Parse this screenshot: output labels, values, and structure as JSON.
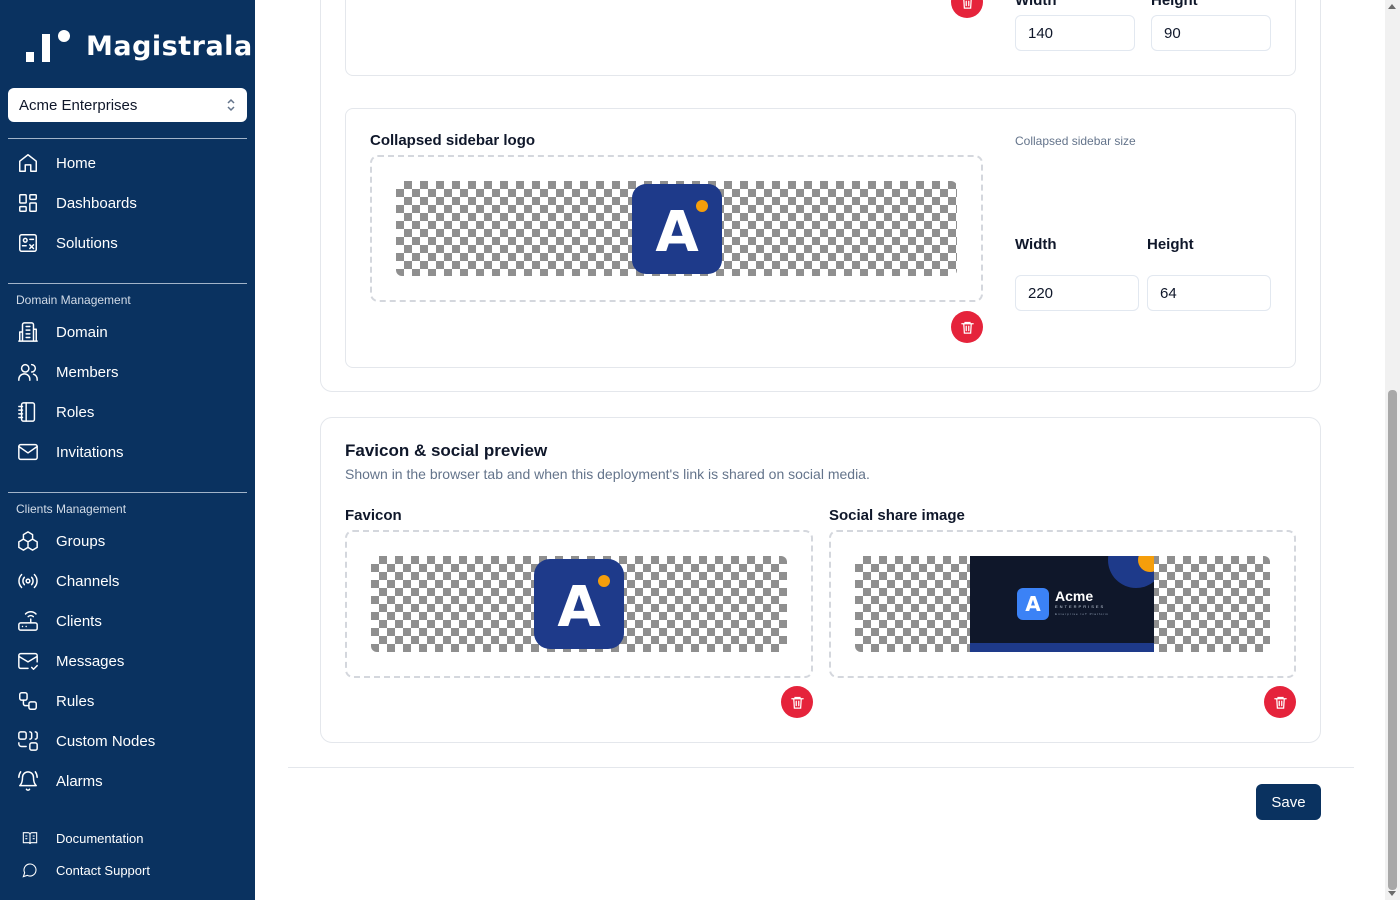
{
  "app": {
    "name": "Magistrala"
  },
  "domain_selector": {
    "value": "Acme Enterprises"
  },
  "nav": {
    "main": [
      {
        "label": "Home",
        "icon": "home-icon"
      },
      {
        "label": "Dashboards",
        "icon": "dashboard-icon"
      },
      {
        "label": "Solutions",
        "icon": "solutions-icon"
      }
    ],
    "domain_section": "Domain Management",
    "domain_items": [
      {
        "label": "Domain",
        "icon": "building-icon"
      },
      {
        "label": "Members",
        "icon": "users-icon"
      },
      {
        "label": "Roles",
        "icon": "notebook-icon"
      },
      {
        "label": "Invitations",
        "icon": "mail-icon"
      }
    ],
    "clients_section": "Clients Management",
    "clients_items": [
      {
        "label": "Groups",
        "icon": "boxes-icon"
      },
      {
        "label": "Channels",
        "icon": "radio-icon"
      },
      {
        "label": "Clients",
        "icon": "router-icon"
      },
      {
        "label": "Messages",
        "icon": "mail-open-icon"
      },
      {
        "label": "Rules",
        "icon": "workflow-icon"
      },
      {
        "label": "Custom Nodes",
        "icon": "nodes-icon"
      },
      {
        "label": "Alarms",
        "icon": "bell-icon"
      }
    ],
    "footer": [
      {
        "label": "Documentation",
        "icon": "book-icon"
      },
      {
        "label": "Contact Support",
        "icon": "chat-icon"
      }
    ]
  },
  "top_partial": {
    "width_label": "Width",
    "height_label": "Height",
    "width_value": "140",
    "height_value": "90"
  },
  "collapsed_logo": {
    "title": "Collapsed sidebar logo",
    "size_label": "Collapsed sidebar size",
    "width_label": "Width",
    "height_label": "Height",
    "width_value": "220",
    "height_value": "64",
    "logo_letter": "A"
  },
  "favicon_section": {
    "title": "Favicon & social preview",
    "description": "Shown in the browser tab and when this deployment's link is shared on social media.",
    "favicon_label": "Favicon",
    "social_label": "Social share image",
    "favicon_letter": "A",
    "social_brand": "Acme",
    "social_sub": "ENTERPRISES",
    "social_tag": "Enterprise IoT Platform"
  },
  "actions": {
    "save_label": "Save"
  },
  "colors": {
    "sidebar": "#0a3260",
    "danger": "#e5233b",
    "logo_bg": "#1e3a8a",
    "accent_dot": "#f59e0b"
  }
}
